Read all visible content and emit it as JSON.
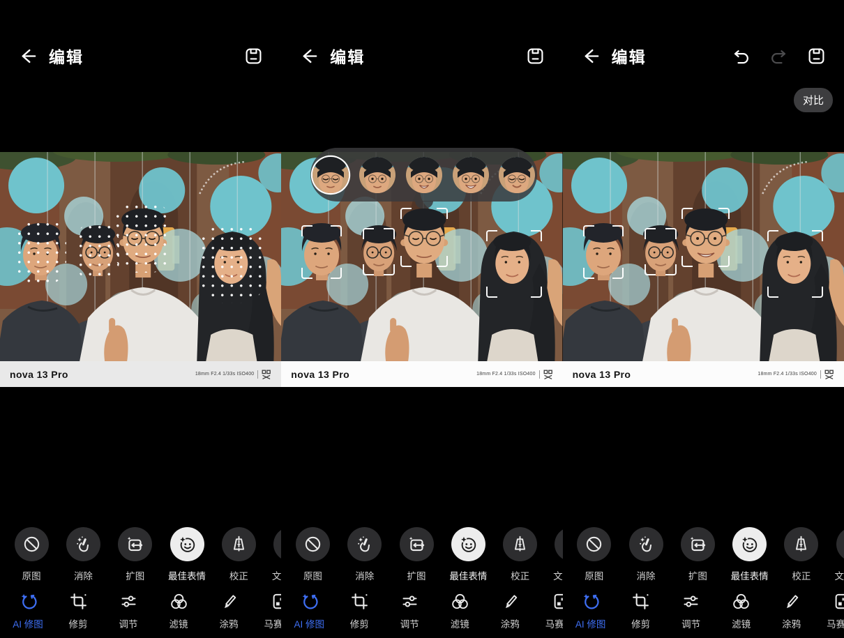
{
  "header": {
    "title": "编辑",
    "compare_label": "对比",
    "icons": [
      "back-arrow-icon",
      "undo-icon",
      "redo-icon",
      "save-icon"
    ]
  },
  "watermark": {
    "brand": "nova 13 Pro",
    "camera_info": "18mm F2.4 1/33s ISO400",
    "logo_icon": "xmage-logo-icon"
  },
  "face_selector": {
    "selected_index": 0,
    "thumbs": [
      {
        "expression": "eyes-closed-neutral",
        "selected": true
      },
      {
        "expression": "neutral",
        "selected": false
      },
      {
        "expression": "open-smile",
        "selected": false
      },
      {
        "expression": "big-smile",
        "selected": false
      },
      {
        "expression": "closed-eye-smile",
        "selected": false
      }
    ]
  },
  "toolbar": {
    "functions": [
      {
        "label": "原图",
        "icon": "original-photo-icon",
        "selected": false
      },
      {
        "label": "消除",
        "icon": "ai-erase-icon",
        "selected": false
      },
      {
        "label": "扩图",
        "icon": "ai-expand-icon",
        "selected": false
      },
      {
        "label": "最佳表情",
        "icon": "best-expression-icon",
        "selected": true
      },
      {
        "label": "校正",
        "icon": "perspective-correct-icon",
        "selected": false
      },
      {
        "label": "文",
        "icon": "text-icon",
        "selected": false,
        "clipped": true
      }
    ],
    "tabs": [
      {
        "label": "AI 修图",
        "icon": "ai-retouch-icon",
        "selected": true
      },
      {
        "label": "修剪",
        "icon": "crop-icon",
        "selected": false
      },
      {
        "label": "调节",
        "icon": "adjust-icon",
        "selected": false
      },
      {
        "label": "滤镜",
        "icon": "filter-icon",
        "selected": false
      },
      {
        "label": "涂鸦",
        "icon": "doodle-icon",
        "selected": false
      },
      {
        "label": "马赛",
        "icon": "mosaic-icon",
        "selected": false,
        "clipped": true
      }
    ]
  },
  "colors": {
    "accent": "#3e6ef2",
    "circlebg": "#2d2d2f",
    "circlesel": "#ededed",
    "comparebg": "#3d3d3f",
    "labelgray": "#d2d2d2",
    "wmbg": "#fcfcfc",
    "wmbg1": "#e9e9e9",
    "stripbg": "rgba(58,58,60,0.85)"
  }
}
